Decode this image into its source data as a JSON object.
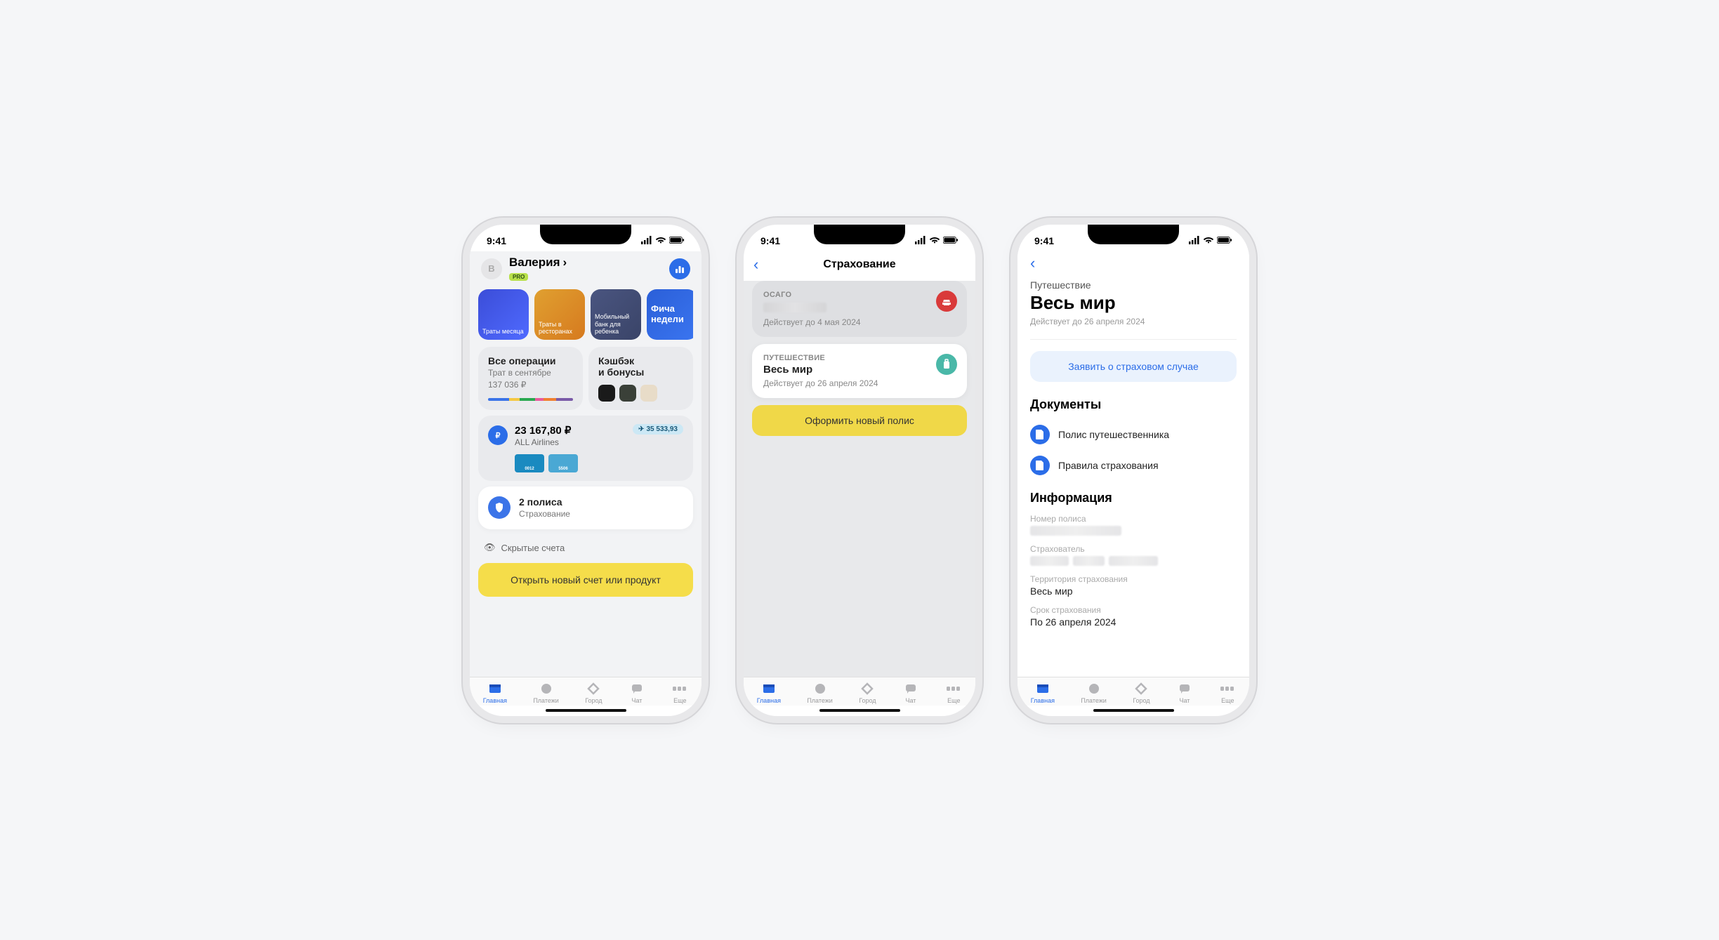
{
  "status": {
    "time": "9:41"
  },
  "tabs": {
    "home": "Главная",
    "payments": "Платежи",
    "city": "Город",
    "chat": "Чат",
    "more": "Еще"
  },
  "phone1": {
    "avatar_initial": "В",
    "user_name": "Валерия",
    "pro_label": "PRO",
    "stories": [
      {
        "label": "Траты месяца"
      },
      {
        "label": "Траты в ресторанах"
      },
      {
        "label": "Мобильный банк для ребенка"
      },
      {
        "label": "Фича недели"
      }
    ],
    "all_ops": {
      "title": "Все операции",
      "sub1": "Трат в сентябре",
      "sub2": "137 036 ₽"
    },
    "cashback": {
      "title": "Кэшбэк",
      "title2": "и бонусы"
    },
    "account": {
      "balance": "23 167,80 ₽",
      "name": "ALL Airlines",
      "miles": "35 533,93",
      "card1": "0012",
      "card2": "5506"
    },
    "insurance": {
      "title": "2 полиса",
      "sub": "Страхование"
    },
    "hidden": "Скрытые счета",
    "cta": "Открыть новый счет или продукт"
  },
  "phone2": {
    "title": "Страхование",
    "policy1": {
      "cat": "ОСАГО",
      "until": "Действует до 4 мая 2024"
    },
    "policy2": {
      "cat": "ПУТЕШЕСТВИЕ",
      "name": "Весь мир",
      "until": "Действует до 26 апреля 2024"
    },
    "cta": "Оформить новый полис"
  },
  "phone3": {
    "cat": "Путешествие",
    "title": "Весь мир",
    "until": "Действует до 26 апреля 2024",
    "claim": "Заявить о страховом случае",
    "docs_h": "Документы",
    "doc1": "Полис путешественника",
    "doc2": "Правила страхования",
    "info_h": "Информация",
    "f1_label": "Номер полиса",
    "f2_label": "Страхователь",
    "f3_label": "Территория страхования",
    "f3_value": "Весь мир",
    "f4_label": "Срок страхования",
    "f4_value": "По 26 апреля 2024"
  }
}
